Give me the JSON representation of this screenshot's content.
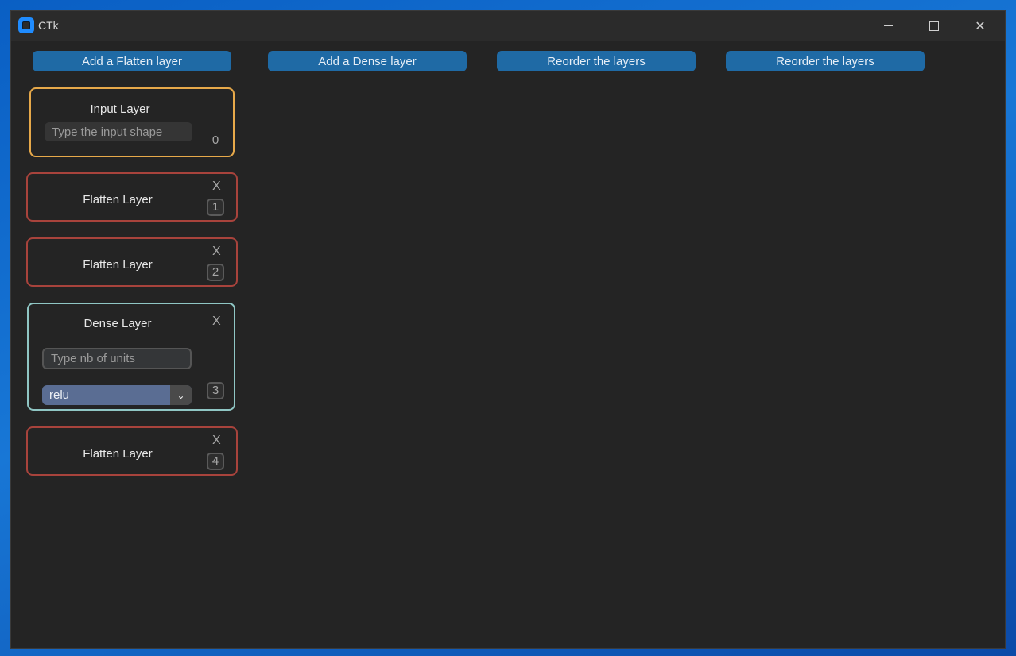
{
  "window": {
    "title": "CTk"
  },
  "toolbar": {
    "buttons": [
      {
        "label": "Add a Flatten layer"
      },
      {
        "label": "Add a Dense layer"
      },
      {
        "label": "Reorder the layers"
      },
      {
        "label": "Reorder the layers"
      }
    ]
  },
  "layers": {
    "input": {
      "title": "Input Layer",
      "placeholder": "Type the input shape",
      "index": "0"
    },
    "flatten_1": {
      "title": "Flatten Layer",
      "close": "X",
      "index": "1"
    },
    "flatten_2": {
      "title": "Flatten Layer",
      "close": "X",
      "index": "2"
    },
    "dense_3": {
      "title": "Dense Layer",
      "close": "X",
      "index": "3",
      "units_placeholder": "Type nb of units",
      "activation": "relu"
    },
    "flatten_4": {
      "title": "Flatten Layer",
      "close": "X",
      "index": "4"
    }
  },
  "colors": {
    "input_border": "#e7a94a",
    "flatten_border": "#a8433c",
    "dense_border": "#8fc6c4",
    "button_bg": "#1f6aa5"
  }
}
